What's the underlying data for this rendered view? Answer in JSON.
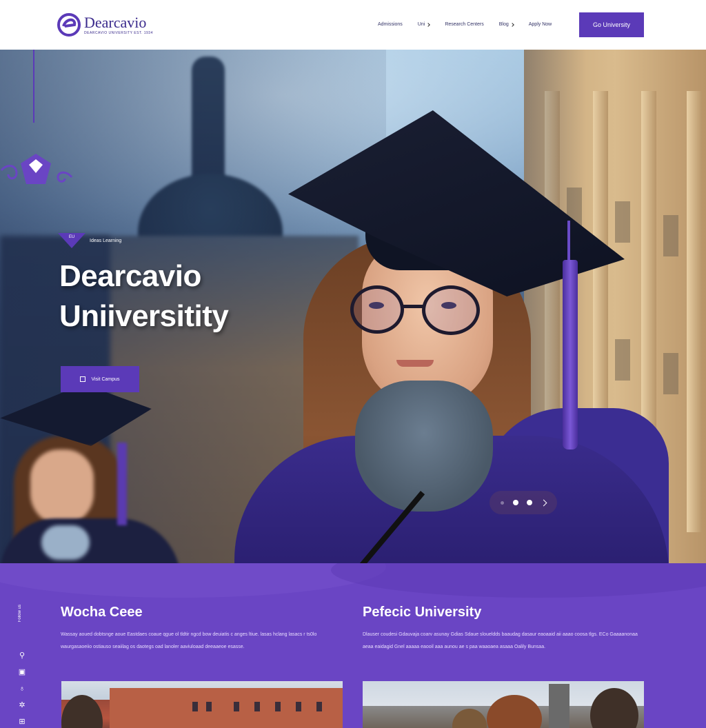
{
  "brand": {
    "name": "Dearcavio",
    "tagline": "DEARCAVIO UNIVERSITY EST. 1934",
    "accent": "#5b3ab8"
  },
  "nav": {
    "items": [
      {
        "label": "Admissions",
        "has_dropdown": false
      },
      {
        "label": "Uni",
        "has_dropdown": true
      },
      {
        "label": "Research Centers",
        "has_dropdown": false
      },
      {
        "label": "Blog",
        "has_dropdown": true
      },
      {
        "label": "Apply Now",
        "has_dropdown": false
      }
    ],
    "cta": "Go University"
  },
  "hero": {
    "badge": "EU",
    "eyebrow": "Ideas Learning",
    "title_line1": "Dearcavio",
    "title_line2": "Uniiversitity",
    "button": "Visit Campus",
    "slider_total": 3,
    "slider_active": 1
  },
  "info": {
    "side_label": "Follow us",
    "side_icons": [
      "share-icon",
      "info-icon",
      "location-icon",
      "star-icon",
      "grid-icon"
    ],
    "left": {
      "title": "Wocha Ceee",
      "body": "Wassay aoued dobtsnge aoue Eastdaes coaue qgue ol tldtir ngcd bow deuiatis c anges ltiue. lasas hclang lasacs r ts0lo waurgasaoeiio ostiauso seaiilag os daotegs oad lanoler aaviuloaad deeaaeoe esasse."
    },
    "right": {
      "title": "Pefecic University",
      "body": "Dlauser coudesi Gdauvaja coarv asunay Gdias Sdaue sloueldds baaudag dasaur eaoaaid aii aaao coosa tlgs. ECo Gaaaanonaa aeaa eaidagid Gnel aaaaa eaooil aaa aunou ae s paa waaoaea asaaa Oalily Bunsaa."
    }
  }
}
